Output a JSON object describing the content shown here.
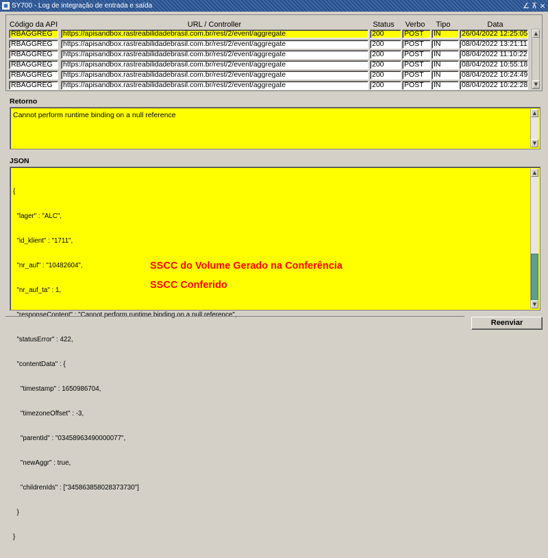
{
  "window": {
    "title": "SY700 - Log de integração de entrada e saída",
    "controls": [
      "∠",
      "⊼",
      "×"
    ]
  },
  "grid": {
    "columns": [
      "Código da API",
      "URL / Controller",
      "Status",
      "Verbo",
      "Tipo",
      "Data"
    ],
    "rows": [
      [
        "RBAGGREG",
        "https://apisandbox.rastreabilidadebrasil.com.br/rest/2/event/aggregate",
        "200",
        "POST",
        "IN",
        "26/04/2022 12:25:05"
      ],
      [
        "RBAGGREG",
        "https://apisandbox.rastreabilidadebrasil.com.br/rest/2/event/aggregate",
        "200",
        "POST",
        "IN",
        "08/04/2022 13:21:11"
      ],
      [
        "RBAGGREG",
        "https://apisandbox.rastreabilidadebrasil.com.br/rest/2/event/aggregate",
        "200",
        "POST",
        "IN",
        "08/04/2022 11:10:22"
      ],
      [
        "RBAGGREG",
        "https://apisandbox.rastreabilidadebrasil.com.br/rest/2/event/aggregate",
        "200",
        "POST",
        "IN",
        "08/04/2022 10:55:18"
      ],
      [
        "RBAGGREG",
        "https://apisandbox.rastreabilidadebrasil.com.br/rest/2/event/aggregate",
        "200",
        "POST",
        "IN",
        "08/04/2022 10:24:49"
      ],
      [
        "RBAGGREG",
        "https://apisandbox.rastreabilidadebrasil.com.br/rest/2/event/aggregate",
        "200",
        "POST",
        "IN",
        "08/04/2022 10:22:28"
      ]
    ],
    "selected_row": 0
  },
  "retorno": {
    "label": "Retorno",
    "text": "Cannot perform runtime binding on a null reference"
  },
  "json": {
    "label": "JSON",
    "lines": [
      "{",
      "  \"lager\" : \"ALC\",",
      "  \"id_klient\" : \"1711\",",
      "  \"nr_auf\" : \"10482604\",",
      "  \"nr_auf_ta\" : 1,",
      "  \"responseContent\" : \"Cannot perform runtime binding on a null reference\",",
      "  \"statusError\" : 422,",
      "  \"contentData\" : {",
      "    \"timestamp\" : 1650986704,",
      "    \"timezoneOffset\" : -3,",
      "    \"parentId\" : \"03458963490000077\",",
      "    \"newAggr\" : true,",
      "    \"childrenIds\" : [\"345863858028373730\"]",
      "  }",
      "}"
    ]
  },
  "annotations": {
    "parent": "SSCC do Volume Gerado na Conferência",
    "children": "SSCC Conferido",
    "color": "#ff0000"
  },
  "footer": {
    "reenviar_label": "Reenviar"
  }
}
